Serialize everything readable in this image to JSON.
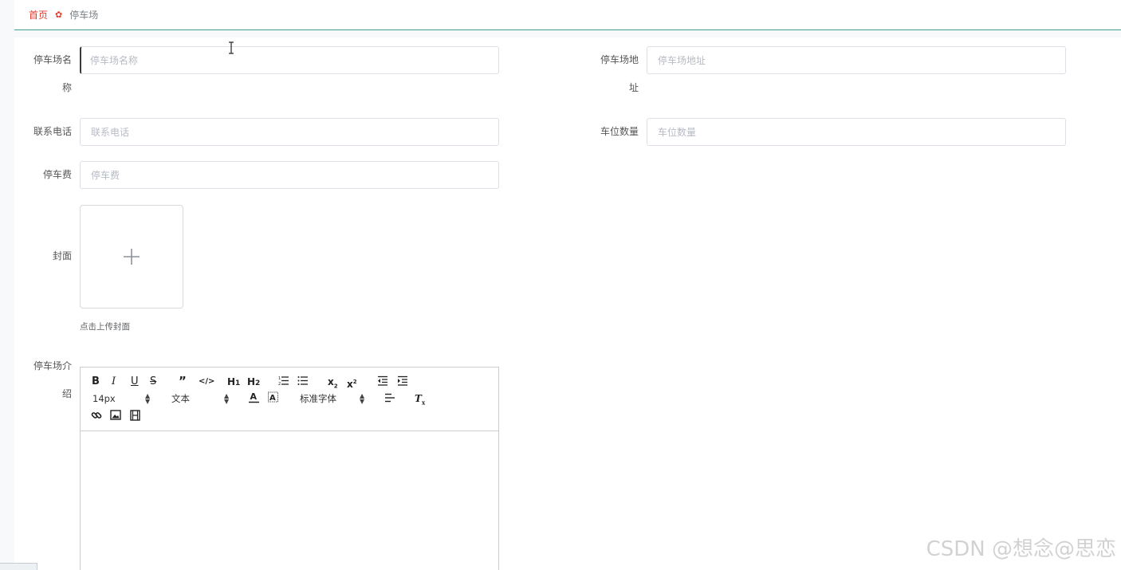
{
  "breadcrumb": {
    "home": "首页",
    "separator_icon": "home-flower-icon",
    "current": "停车场"
  },
  "form": {
    "name": {
      "label": "停车场名称",
      "placeholder": "停车场名称",
      "value": ""
    },
    "address": {
      "label": "停车场地址",
      "placeholder": "停车场地址",
      "value": ""
    },
    "phone": {
      "label": "联系电话",
      "placeholder": "联系电话",
      "value": ""
    },
    "spaces": {
      "label": "车位数量",
      "placeholder": "车位数量",
      "value": ""
    },
    "fee": {
      "label": "停车费",
      "placeholder": "停车费",
      "value": ""
    },
    "cover": {
      "label": "封面",
      "tip": "点击上传封面",
      "icon": "plus-icon"
    },
    "intro": {
      "label": "停车场介绍"
    }
  },
  "editor": {
    "size_select": "14px",
    "header_select": "文本",
    "font_select": "标准字体",
    "buttons": [
      "bold",
      "italic",
      "underline",
      "strike",
      "blockquote",
      "code-block",
      "header-1",
      "header-2",
      "ordered-list",
      "bullet-list",
      "subscript",
      "superscript",
      "outdent",
      "indent",
      "color",
      "background",
      "align",
      "clean",
      "link",
      "image",
      "video"
    ]
  },
  "watermark": "CSDN @想念@思恋",
  "colors": {
    "accent_red": "#e43b2d",
    "divider_teal": "#3f9e95",
    "border": "#dcdfe6",
    "placeholder": "#b6bbc3"
  }
}
